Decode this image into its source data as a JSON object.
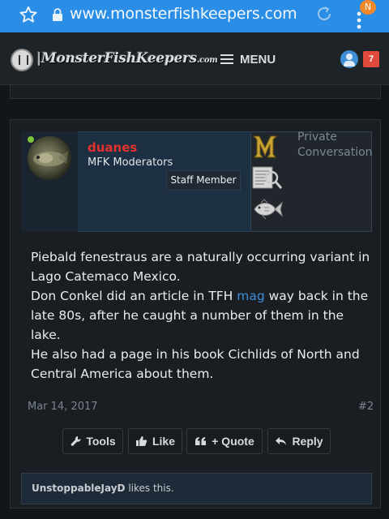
{
  "browser": {
    "url": "www.monsterfishkeepers.com",
    "notification_badge": "N",
    "accent_color": "#2a8ee6"
  },
  "header": {
    "logo_main": "MonsterFishKeepers",
    "logo_suffix": ".com",
    "menu_label": "MENU",
    "alert_count": "7"
  },
  "post": {
    "username": "duanes",
    "user_group": "MFK Moderators",
    "staff_badge": "Staff Member",
    "private_conversation": "Private Conversation",
    "online": true,
    "body": {
      "line1": "Piebald fenestraus are a naturally occurring variant in Lago Catemaco Mexico.",
      "line2_before": "Don Conkel did an article in TFH ",
      "line2_link": "mag",
      "line2_after": " way back in the late 80s, after he caught a number of them in the lake.",
      "line3": "He also had a page in his book Cichlids of North and Central America about them."
    },
    "date": "Mar 14, 2017",
    "number": "#2",
    "actions": {
      "tools": "Tools",
      "like": "Like",
      "quote": "+ Quote",
      "reply": "Reply"
    },
    "likes": {
      "user": "UnstoppableJayD",
      "text": " likes this."
    }
  }
}
